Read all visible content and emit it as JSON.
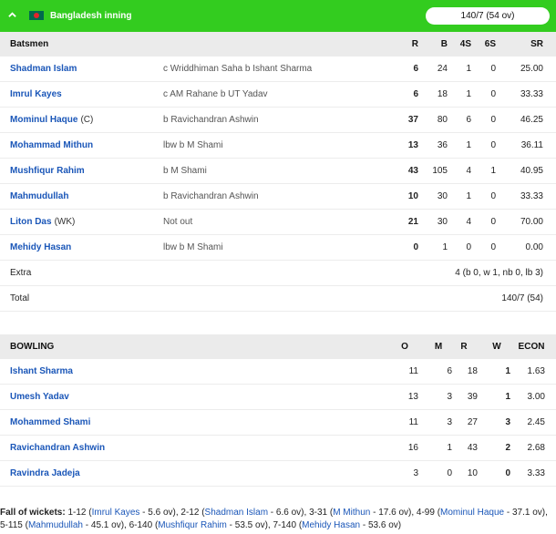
{
  "header": {
    "title": "Bangladesh inning",
    "score": "140/7 (54 ov)",
    "accent": "#33cc1f"
  },
  "batting": {
    "columns": {
      "name": "Batsmen",
      "R": "R",
      "B": "B",
      "fours": "4S",
      "sixes": "6S",
      "SR": "SR"
    },
    "rows": [
      {
        "name": "Shadman Islam",
        "role": "",
        "dismissal": "c Wriddhiman Saha b Ishant Sharma",
        "R": "6",
        "B": "24",
        "fours": "1",
        "sixes": "0",
        "SR": "25.00"
      },
      {
        "name": "Imrul Kayes",
        "role": "",
        "dismissal": "c AM Rahane b UT Yadav",
        "R": "6",
        "B": "18",
        "fours": "1",
        "sixes": "0",
        "SR": "33.33"
      },
      {
        "name": "Mominul Haque",
        "role": "(C)",
        "dismissal": "b Ravichandran Ashwin",
        "R": "37",
        "B": "80",
        "fours": "6",
        "sixes": "0",
        "SR": "46.25"
      },
      {
        "name": "Mohammad Mithun",
        "role": "",
        "dismissal": "lbw b M Shami",
        "R": "13",
        "B": "36",
        "fours": "1",
        "sixes": "0",
        "SR": "36.11"
      },
      {
        "name": "Mushfiqur Rahim",
        "role": "",
        "dismissal": "b M Shami",
        "R": "43",
        "B": "105",
        "fours": "4",
        "sixes": "1",
        "SR": "40.95"
      },
      {
        "name": "Mahmudullah",
        "role": "",
        "dismissal": "b Ravichandran Ashwin",
        "R": "10",
        "B": "30",
        "fours": "1",
        "sixes": "0",
        "SR": "33.33"
      },
      {
        "name": "Liton Das",
        "role": "(WK)",
        "dismissal": "Not out",
        "R": "21",
        "B": "30",
        "fours": "4",
        "sixes": "0",
        "SR": "70.00"
      },
      {
        "name": "Mehidy Hasan",
        "role": "",
        "dismissal": "lbw b M Shami",
        "R": "0",
        "B": "1",
        "fours": "0",
        "sixes": "0",
        "SR": "0.00"
      }
    ],
    "extra_label": "Extra",
    "extra_value": "4 (b 0, w 1, nb 0, lb 3)",
    "total_label": "Total",
    "total_value": "140/7 (54)"
  },
  "bowling": {
    "columns": {
      "name": "BOWLING",
      "O": "O",
      "M": "M",
      "R": "R",
      "W": "W",
      "ECON": "ECON"
    },
    "rows": [
      {
        "name": "Ishant Sharma",
        "O": "11",
        "M": "6",
        "R": "18",
        "W": "1",
        "ECON": "1.63"
      },
      {
        "name": "Umesh Yadav",
        "O": "13",
        "M": "3",
        "R": "39",
        "W": "1",
        "ECON": "3.00"
      },
      {
        "name": "Mohammed Shami",
        "O": "11",
        "M": "3",
        "R": "27",
        "W": "3",
        "ECON": "2.45"
      },
      {
        "name": "Ravichandran Ashwin",
        "O": "16",
        "M": "1",
        "R": "43",
        "W": "2",
        "ECON": "2.68"
      },
      {
        "name": "Ravindra Jadeja",
        "O": "3",
        "M": "0",
        "R": "10",
        "W": "0",
        "ECON": "3.33"
      }
    ]
  },
  "fall_of_wickets": {
    "label": "Fall of wickets:",
    "items": [
      {
        "score": "1-12",
        "player": "Imrul Kayes",
        "over": "5.6 ov"
      },
      {
        "score": "2-12",
        "player": "Shadman Islam",
        "over": "6.6 ov"
      },
      {
        "score": "3-31",
        "player": "M Mithun",
        "over": "17.6 ov"
      },
      {
        "score": "4-99",
        "player": "Mominul Haque",
        "over": "37.1 ov"
      },
      {
        "score": "5-115",
        "player": "Mahmudullah",
        "over": "45.1 ov"
      },
      {
        "score": "6-140",
        "player": "Mushfiqur Rahim",
        "over": "53.5 ov"
      },
      {
        "score": "7-140",
        "player": "Mehidy Hasan",
        "over": "53.6 ov"
      }
    ]
  }
}
